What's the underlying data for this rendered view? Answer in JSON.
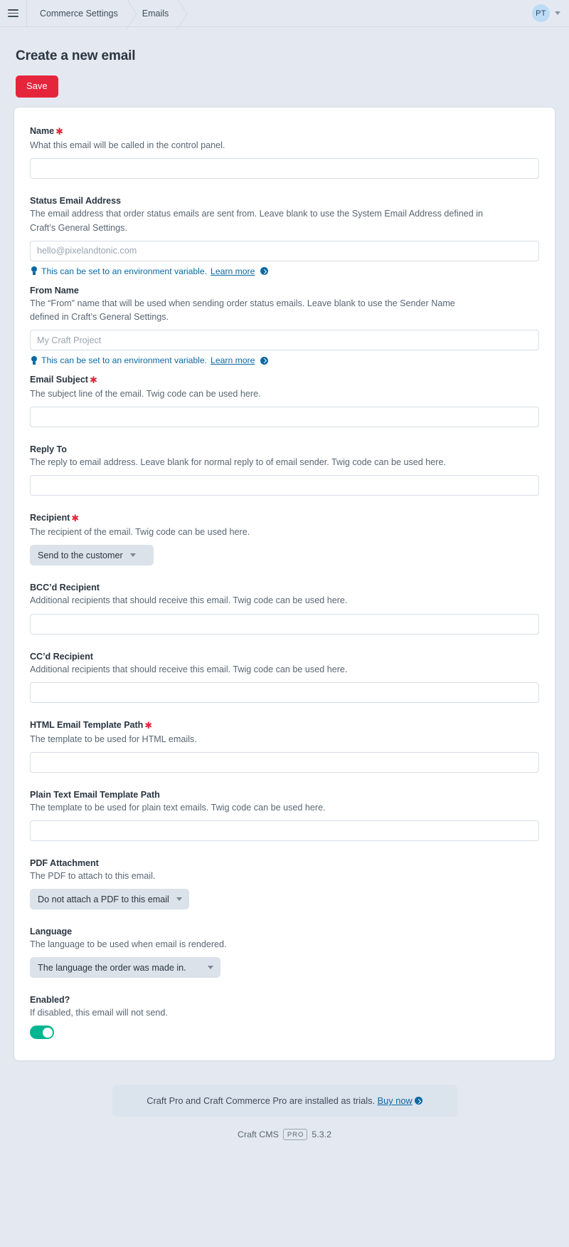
{
  "globalnav": {
    "menu_label": "Menu",
    "breadcrumbs": [
      {
        "label": "Commerce Settings"
      },
      {
        "label": "Emails"
      }
    ],
    "account_initials": "PT"
  },
  "page": {
    "title": "Create a new email",
    "save_label": "Save"
  },
  "tip": {
    "text": "This can be set to an environment variable.",
    "link_label": "Learn more"
  },
  "fields": {
    "name": {
      "label": "Name",
      "required": "✱",
      "instructions": "What this email will be called in the control panel.",
      "value": "",
      "placeholder": ""
    },
    "status_email_address": {
      "label": "Status Email Address",
      "instructions": "The email address that order status emails are sent from. Leave blank to use the System Email Address defined in Craft’s General Settings.",
      "value": "",
      "placeholder": "hello@pixelandtonic.com"
    },
    "from_name": {
      "label": "From Name",
      "instructions": "The “From” name that will be used when sending order status emails. Leave blank to use the Sender Name defined in Craft’s General Settings.",
      "value": "",
      "placeholder": "My Craft Project"
    },
    "email_subject": {
      "label": "Email Subject",
      "required": "✱",
      "instructions": "The subject line of the email. Twig code can be used here.",
      "value": "",
      "placeholder": ""
    },
    "reply_to": {
      "label": "Reply To",
      "instructions": "The reply to email address. Leave blank for normal reply to of email sender. Twig code can be used here.",
      "value": "",
      "placeholder": ""
    },
    "recipient": {
      "label": "Recipient",
      "required": "✱",
      "instructions": "The recipient of the email. Twig code can be used here.",
      "selected": "Send to the customer"
    },
    "bcc_recipient": {
      "label": "BCC’d Recipient",
      "instructions": "Additional recipients that should receive this email. Twig code can be used here.",
      "value": "",
      "placeholder": ""
    },
    "cc_recipient": {
      "label": "CC’d Recipient",
      "instructions": "Additional recipients that should receive this email. Twig code can be used here.",
      "value": "",
      "placeholder": ""
    },
    "html_template_path": {
      "label": "HTML Email Template Path",
      "required": "✱",
      "instructions": "The template to be used for HTML emails.",
      "value": "",
      "placeholder": ""
    },
    "plain_text_template_path": {
      "label": "Plain Text Email Template Path",
      "instructions": "The template to be used for plain text emails. Twig code can be used here.",
      "value": "",
      "placeholder": ""
    },
    "pdf_attachment": {
      "label": "PDF Attachment",
      "instructions": "The PDF to attach to this email.",
      "selected": "Do not attach a PDF to this email"
    },
    "language": {
      "label": "Language",
      "instructions": "The language to be used when email is rendered.",
      "selected": "The language the order was made in."
    },
    "enabled": {
      "label": "Enabled?",
      "instructions": "If disabled, this email will not send.",
      "state": "on"
    }
  },
  "footer": {
    "trial_text": "Craft Pro and Craft Commerce Pro are installed as trials.",
    "trial_link": "Buy now",
    "product": "Craft CMS",
    "edition": "PRO",
    "version": "5.3.2"
  },
  "colors": {
    "accent_red": "#e5253b",
    "link_blue": "#0b69a3",
    "toggle_green": "#00b58f",
    "page_bg": "#e4e9f1"
  }
}
